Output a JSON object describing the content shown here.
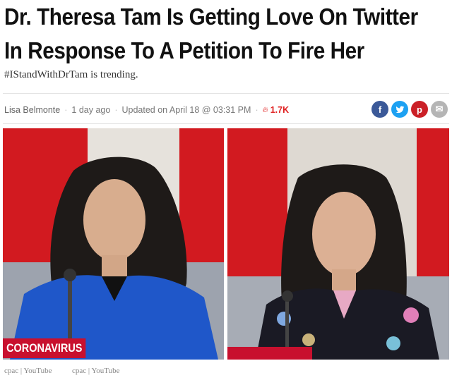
{
  "article": {
    "headline_line1": "Dr. Theresa Tam Is Getting Love On Twitter",
    "headline_line2": "In Response To A Petition To Fire Her",
    "subhead": "#IStandWithDrTam is trending."
  },
  "meta": {
    "author": "Lisa Belmonte",
    "sep": "·",
    "posted": "1 day ago",
    "updated": "Updated on April 18 @ 03:31 PM",
    "views": "1.7K"
  },
  "social": {
    "facebook": "f",
    "twitter": "t",
    "pinterest": "p",
    "email": "✉"
  },
  "photos": {
    "left_caption": "CORONAVIRUS",
    "left_credit": "cpac | YouTube",
    "right_credit": "cpac | YouTube"
  },
  "colors": {
    "accent_red": "#e02020",
    "flag_red": "#d21a20",
    "blazer_blue": "#1f57c9"
  }
}
